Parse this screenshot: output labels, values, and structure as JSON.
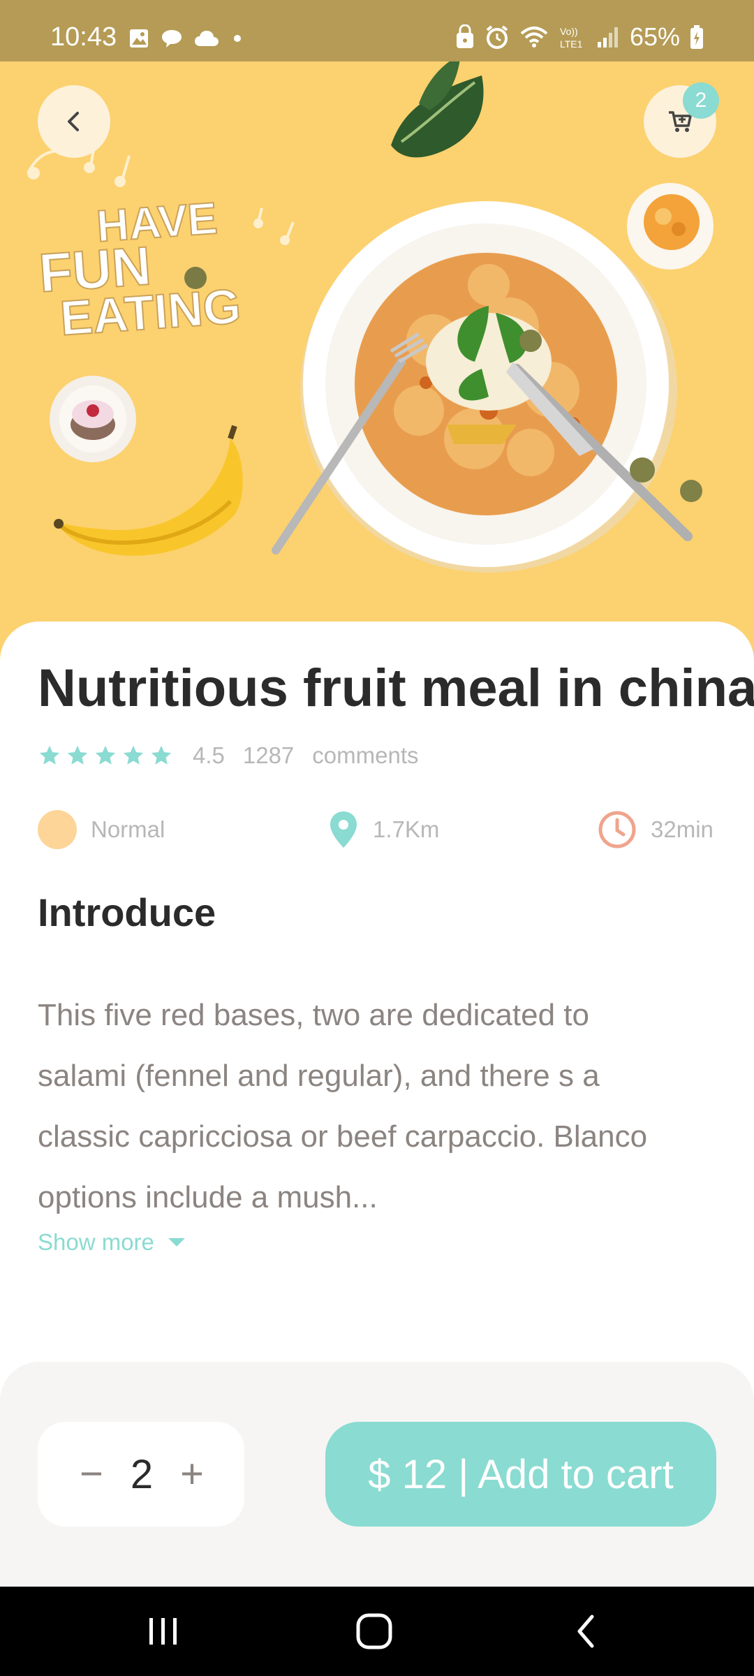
{
  "status_bar": {
    "time": "10:43",
    "battery": "65%",
    "icons": [
      "gallery-icon",
      "chat-icon",
      "cloud-icon",
      "dot-icon",
      "lock-icon",
      "alarm-icon",
      "wifi-icon",
      "volte-icon",
      "signal-icon",
      "battery-icon"
    ]
  },
  "hero": {
    "image_text": "HAVE FUN EATING",
    "cart_badge": "2"
  },
  "product": {
    "title": "Nutritious fruit meal in china",
    "rating": "4.5",
    "review_count": "1287",
    "reviews_label": "comments",
    "stars": 5
  },
  "meta": {
    "spice_level": "Normal",
    "distance": "1.7Km",
    "time": "32min"
  },
  "intro": {
    "heading": "Introduce",
    "lines": [
      "This five red bases, two are dedicated to",
      "salami (fennel and regular), and there s a",
      "classic capricciosa or beef carpaccio. Blanco",
      "options include a mush..."
    ],
    "show_more": "Show more"
  },
  "cart": {
    "quantity": "2",
    "minus": "−",
    "plus": "+",
    "add_label": "$ 12 | Add to cart"
  },
  "colors": {
    "accent": "#8adbd1",
    "hero_bg": "#fcd16f",
    "status_bar": "#b59b55",
    "text_dark": "#2b2b2b",
    "text_muted": "#b7b7b7",
    "clock": "#f0a48c",
    "normal_dot": "#fdd598"
  }
}
